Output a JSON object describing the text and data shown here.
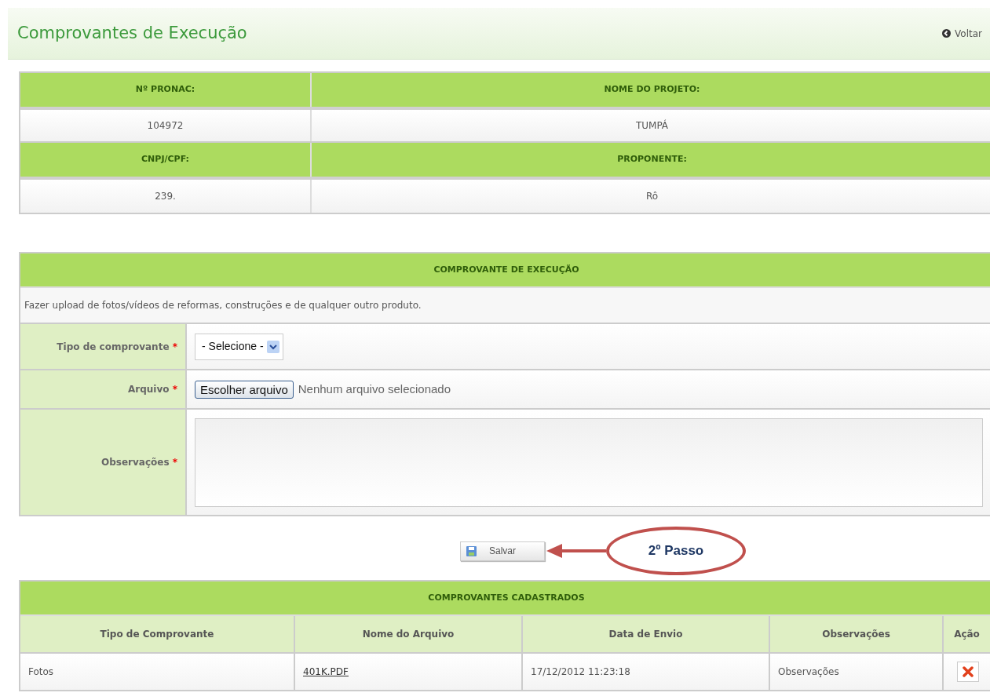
{
  "header": {
    "title": "Comprovantes de Execução",
    "back_link": "Voltar"
  },
  "project_info": [
    {
      "label": "Nº PRONAC:",
      "value": "104972"
    },
    {
      "label": "NOME DO PROJETO:",
      "value": "TUMPÁ"
    },
    {
      "label": "CNPJ/CPF:",
      "value": "239."
    },
    {
      "label": "PROPONENTE:",
      "value": "Rô"
    }
  ],
  "form": {
    "title": "COMPROVANTE DE EXECUÇÃO",
    "description": "Fazer upload de fotos/vídeos de reformas, construções e de qualquer outro produto.",
    "fields": [
      {
        "kind": "select",
        "label": "Tipo de comprovante",
        "required_mark": "*",
        "value": "- Selecione -"
      },
      {
        "kind": "file",
        "label": "Arquivo",
        "required_mark": "*",
        "button": "Escolher arquivo",
        "status": "Nenhum arquivo selecionado"
      },
      {
        "kind": "textarea",
        "label": "Observações",
        "required_mark": "*"
      }
    ],
    "save_button": "Salvar"
  },
  "callout": {
    "text": "2º Passo"
  },
  "registered": {
    "title": "COMPROVANTES CADASTRADOS",
    "columns": [
      "Tipo de Comprovante",
      "Nome do Arquivo",
      "Data de Envio",
      "Observações",
      "Ação"
    ],
    "rows": [
      {
        "type": "Fotos",
        "file": "401K.PDF",
        "date": "17/12/2012 11:23:18",
        "notes": "Observações"
      }
    ]
  }
}
